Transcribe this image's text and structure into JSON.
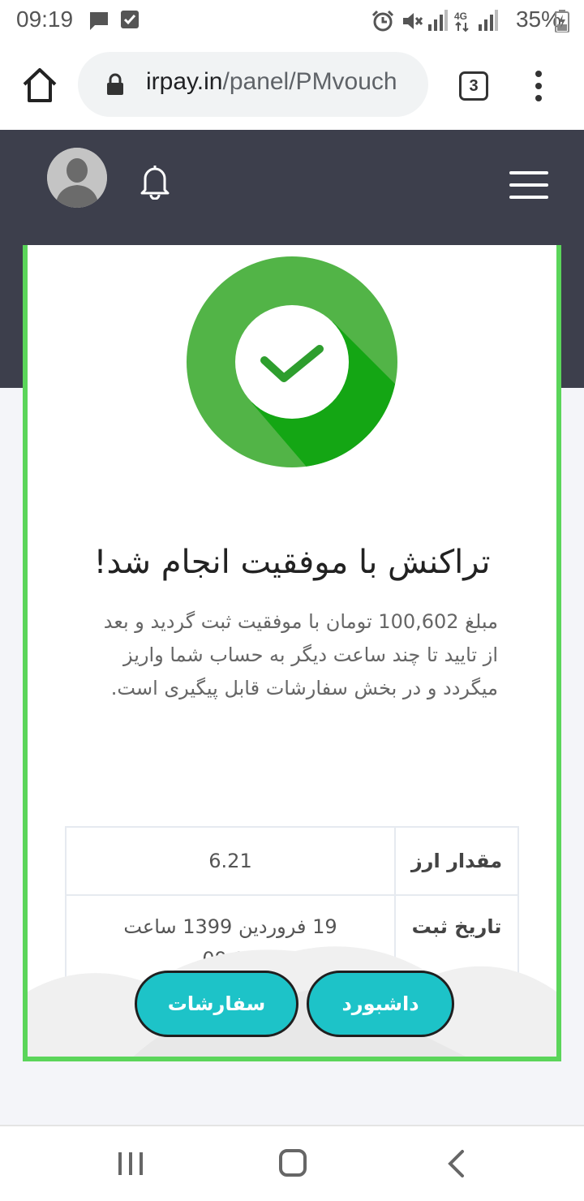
{
  "status_bar": {
    "time": "09:19",
    "battery": "35%",
    "icons": [
      "message-icon",
      "check-box-icon",
      "alarm-icon",
      "mute-icon",
      "signal-icon",
      "4g-icon",
      "battery-charging-icon"
    ]
  },
  "browser": {
    "url_domain": "irpay.in",
    "url_path": "/panel/PMvouch",
    "tab_count": "3"
  },
  "card": {
    "title": "تراکنش با موفقیت انجام شد!",
    "message": "مبلغ 100,602 تومان با موفقیت ثبت گردید و بعد از تایید تا چند ساعت دیگر به حساب شما واریز میگردد و در بخش سفارشات قابل پیگیری است.",
    "rows": [
      {
        "label": "مقدار ارز",
        "value": "6.21"
      },
      {
        "label": "تاریخ ثبت",
        "value": "19 فروردین 1399 ساعت 09:19"
      }
    ],
    "buttons": {
      "dashboard": "داشبورد",
      "orders": "سفارشات"
    }
  },
  "colors": {
    "header_bg": "#3d3f4c",
    "success_green": "#4bb543",
    "card_border": "#5bd55a",
    "button_bg": "#1dc3c8"
  }
}
